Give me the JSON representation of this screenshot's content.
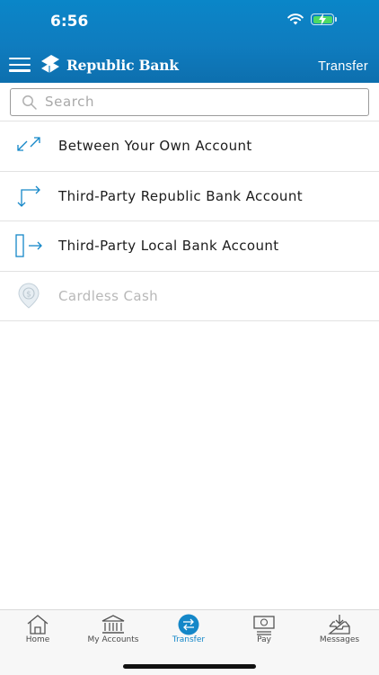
{
  "status_bar": {
    "time": "6:56"
  },
  "app_bar": {
    "brand_name": "Republic Bank",
    "title": "Transfer",
    "menu_icon": "hamburger-menu-icon",
    "logo_icon": "republic-bank-logo"
  },
  "search": {
    "placeholder": "Search",
    "value": ""
  },
  "transfer_options": [
    {
      "label": "Between Your Own Account",
      "icon": "diagonal-arrows-icon",
      "enabled": true
    },
    {
      "label": "Third-Party Republic Bank Account",
      "icon": "corner-arrows-icon",
      "enabled": true
    },
    {
      "label": "Third-Party Local Bank Account",
      "icon": "card-arrow-icon",
      "enabled": true
    },
    {
      "label": "Cardless Cash",
      "icon": "location-dollar-icon",
      "enabled": false
    }
  ],
  "tab_bar": [
    {
      "label": "Home",
      "icon": "home-icon",
      "active": false
    },
    {
      "label": "My Accounts",
      "icon": "bank-icon",
      "active": false
    },
    {
      "label": "Transfer",
      "icon": "transfer-icon",
      "active": true
    },
    {
      "label": "Pay",
      "icon": "pay-icon",
      "active": false
    },
    {
      "label": "Messages",
      "icon": "inbox-icon",
      "active": false
    }
  ],
  "colors": {
    "header_blue": "#0f7cbf",
    "accent_blue": "#1487c8",
    "text_dark": "#1c1c1c",
    "text_disabled": "#b8b8b8",
    "battery_green": "#4cd964"
  }
}
